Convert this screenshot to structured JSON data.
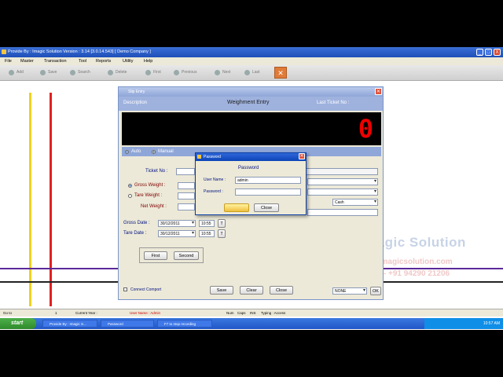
{
  "window": {
    "title": "Provide By : Imagic Solution          Version : 3.14 [3.0.14.543]          [ Demo Company ]",
    "controls": [
      "_",
      "□",
      "X"
    ]
  },
  "menu": [
    "File",
    "Master",
    "Transaction",
    "Tool",
    "Reports",
    "Utility",
    "Help"
  ],
  "toolbar": [
    "Add",
    "Save",
    "Search",
    "Delete",
    "First",
    "Previous",
    "Next",
    "Last"
  ],
  "slip_dialog": {
    "title": "Slip Entry",
    "description_label": "Description",
    "header_title": "Weighment Entry",
    "last_ticket_label": "Last Ticket No :",
    "display_value": "0",
    "mode_auto": "Auto",
    "mode_manual": "Manual",
    "ticket_no_label": "Ticket No :",
    "gross_weight_label": "Gross Weight :",
    "tare_weight_label": "Tare Weight :",
    "net_weight_label": "Net Weight :",
    "gross_date_label": "Gross Date :",
    "tare_date_label": "Tare Date :",
    "gross_date_value": "30/12/2011",
    "tare_date_value": "30/12/2011",
    "gross_time_value": "10:55",
    "tare_time_value": "10:55",
    "time_btn": "T",
    "payment_value": "Cash",
    "first_button": "First",
    "second_button": "Second",
    "connect_label": "Connect Comport",
    "save_button": "Save",
    "clear_button": "Clear",
    "close_button": "Close",
    "printer_value": "NONE",
    "ok_button": "OK"
  },
  "password_dialog": {
    "title": "Password",
    "heading": "Password",
    "username_label": "User Name :",
    "username_value": "admin",
    "password_label": "Password :",
    "password_value": "",
    "ok_button": "",
    "close_button": "Close"
  },
  "watermark": {
    "logo_letter": "I",
    "logo_text": "Magic Solution",
    "website": "www.imagicsolution.com",
    "mobile": "Mob:- +91 94290 21206"
  },
  "statusbar": {
    "f1": "Go to",
    "f2": "1",
    "year": "Current Year :",
    "user": "User Name : Admin",
    "num": "Num",
    "caps": "Caps",
    "insert": "INS",
    "typing": "Typing : Access"
  },
  "taskbar": {
    "start": "start",
    "tasks": [
      "Provide By : Imagic S...",
      "Password",
      "F7 to stop recording"
    ],
    "clock": "10:57 AM"
  },
  "colors": {
    "line_yellow": "#f0d020",
    "line_red": "#e02020",
    "line_purple": "#5a2a9a",
    "display_digit": "#e00000"
  }
}
